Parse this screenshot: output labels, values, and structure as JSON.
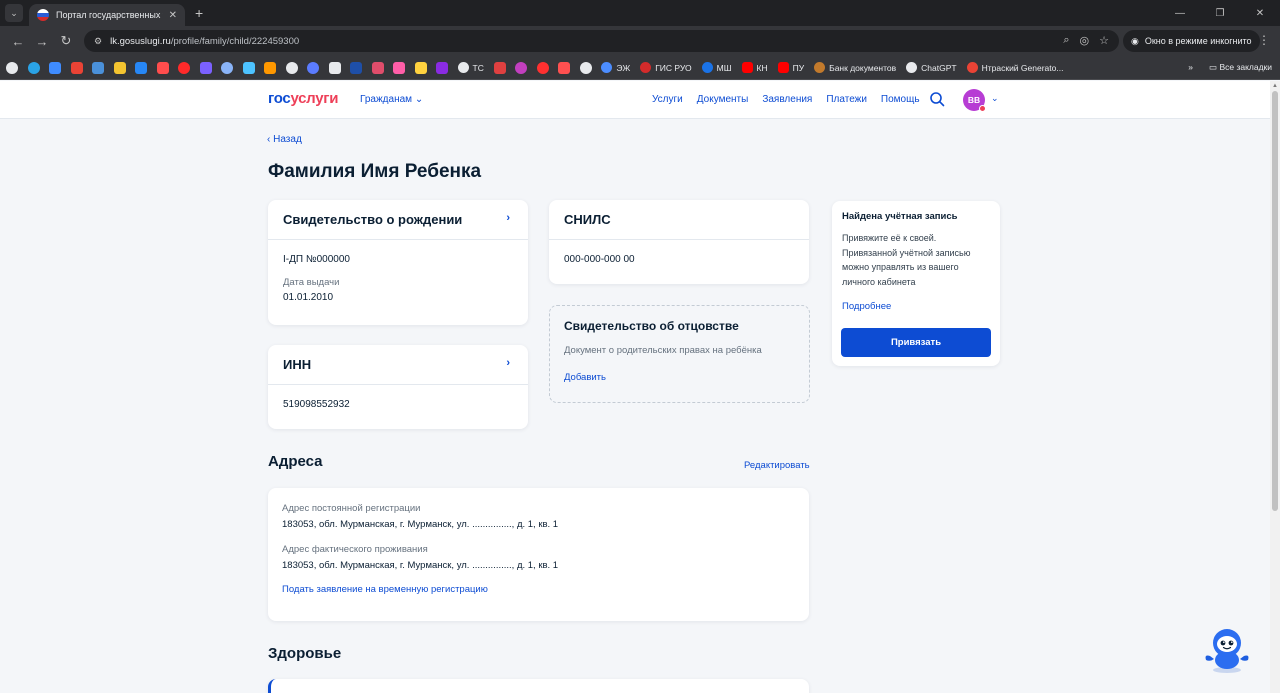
{
  "browser": {
    "tab_title": "Портал государственных услуг",
    "url_domain": "lk.gosuslugi.ru",
    "url_path": "/profile/family/child/222459300",
    "incognito_label": "Окно в режиме инкогнито",
    "bookmarks": [
      {
        "label": "ЭЖ",
        "color": "#4c8dff"
      },
      {
        "label": "ГИС РУО",
        "color": "#d32b2b"
      },
      {
        "label": "МШ",
        "color": "#1a73e8"
      },
      {
        "label": "КН",
        "color": "#ff0000"
      },
      {
        "label": "ПУ",
        "color": "#ff0000"
      },
      {
        "label": "Банк документов",
        "color": "#c27a2c"
      },
      {
        "label": "ChatGPT",
        "color": "#e8eaed"
      },
      {
        "label": "Нтраский Generato...",
        "color": "#ea4335"
      }
    ],
    "all_bookmarks_label": "Все закладки",
    "tc_label": "ТС"
  },
  "header": {
    "logo_part1": "гос",
    "logo_part2": "услуги",
    "citizens_label": "Гражданам",
    "nav": [
      "Услуги",
      "Документы",
      "Заявления",
      "Платежи",
      "Помощь"
    ],
    "avatar_initials": "ВВ"
  },
  "page": {
    "back_label": "Назад",
    "title": "Фамилия Имя Ребенка"
  },
  "birth_certificate": {
    "title": "Свидетельство о рождении",
    "number": "I-ДП №000000",
    "issue_label": "Дата выдачи",
    "issue_date": "01.01.2010"
  },
  "inn": {
    "title": "ИНН",
    "value": "519098552932"
  },
  "snils": {
    "title": "СНИЛС",
    "value": "000-000-000 00"
  },
  "paternity": {
    "title": "Свидетельство об отцовстве",
    "description": "Документ о родительских правах на ребёнка",
    "add_label": "Добавить"
  },
  "account": {
    "title": "Найдена учётная запись",
    "text": "Привяжите её к своей. Привязанной учётной записью можно управлять из вашего личного кабинета",
    "more_label": "Подробнее",
    "button_label": "Привязать"
  },
  "addresses": {
    "title": "Адреса",
    "edit_label": "Редактировать",
    "permanent_label": "Адрес постоянной регистрации",
    "permanent_value": "183053, обл. Мурманская, г. Мурманск, ул. ..............., д. 1, кв. 1",
    "actual_label": "Адрес фактического проживания",
    "actual_value": "183053, обл. Мурманская, г. Мурманск, ул. ..............., д. 1, кв. 1",
    "temp_reg_link": "Подать заявление на временную регистрацию"
  },
  "health": {
    "title": "Здоровье"
  },
  "colors": {
    "brand_blue": "#0d4cd3",
    "brand_red": "#ee3f58",
    "avatar": "#b73dd4"
  }
}
